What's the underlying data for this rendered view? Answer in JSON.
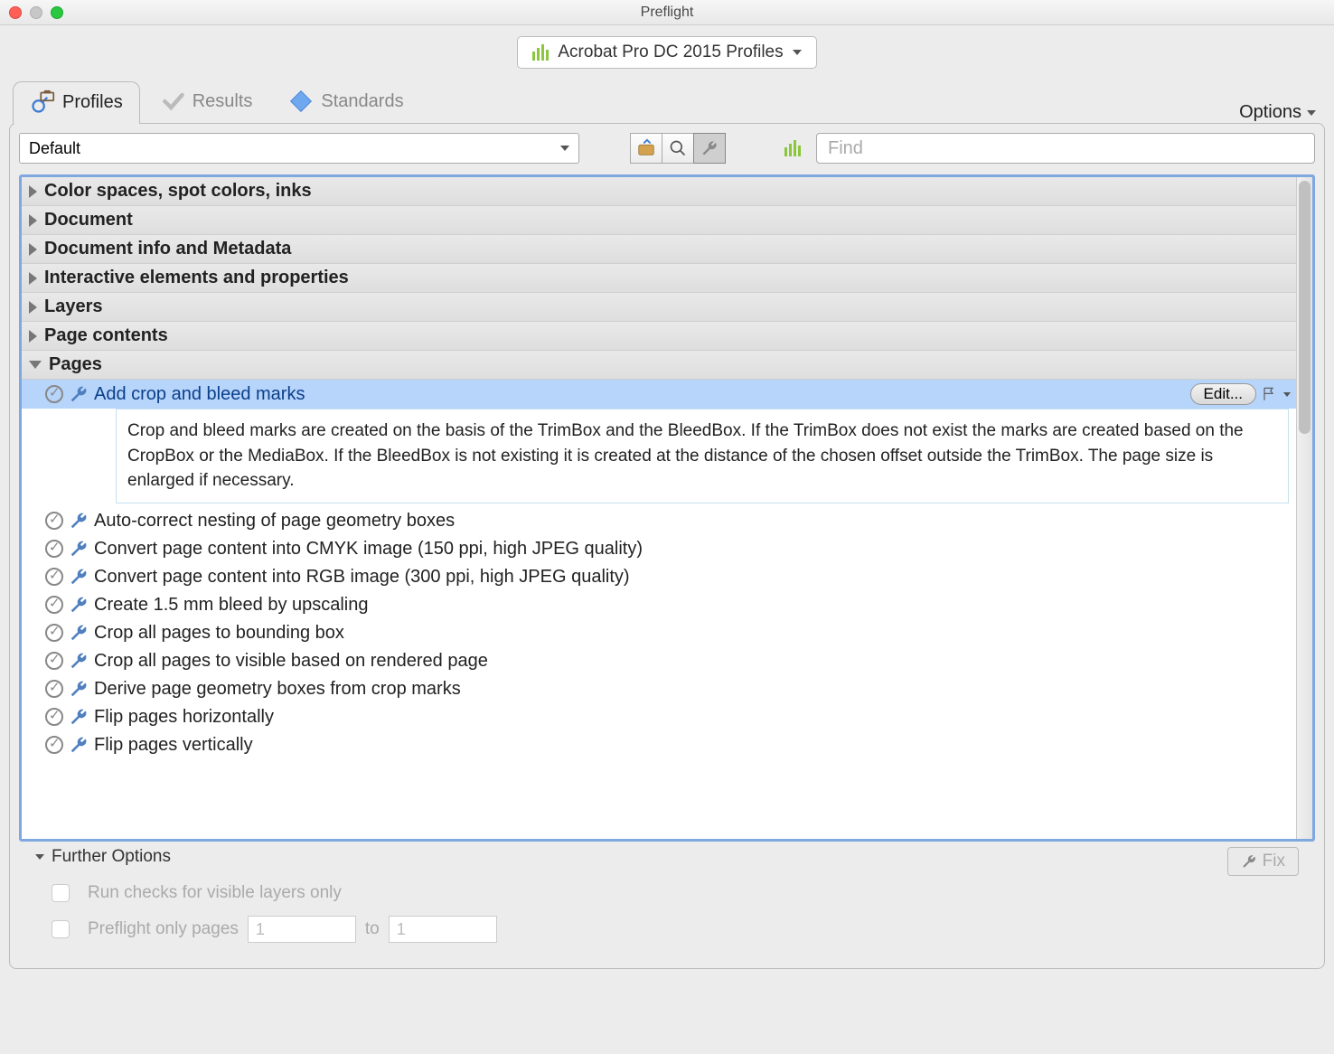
{
  "window": {
    "title": "Preflight"
  },
  "profile_selector": {
    "label": "Acrobat Pro DC 2015 Profiles"
  },
  "tabs": {
    "profiles": "Profiles",
    "results": "Results",
    "standards": "Standards"
  },
  "options_menu": "Options",
  "group_selector": "Default",
  "search": {
    "placeholder": "Find"
  },
  "categories": [
    {
      "label": "Color spaces, spot colors, inks",
      "expanded": false
    },
    {
      "label": "Document",
      "expanded": false
    },
    {
      "label": "Document info and Metadata",
      "expanded": false
    },
    {
      "label": "Interactive elements and properties",
      "expanded": false
    },
    {
      "label": "Layers",
      "expanded": false
    },
    {
      "label": "Page contents",
      "expanded": false
    },
    {
      "label": "Pages",
      "expanded": true
    }
  ],
  "selected_item": {
    "title": "Add crop and bleed marks",
    "edit_label": "Edit...",
    "description": "Crop and bleed marks are created on the basis of the TrimBox and the BleedBox. If the TrimBox does not exist the marks are created based on the CropBox or the MediaBox. If the BleedBox is not existing it is created at the distance of the chosen offset outside the TrimBox. The page size is enlarged if necessary."
  },
  "page_items": [
    "Auto-correct nesting of page geometry boxes",
    "Convert page content into CMYK image (150 ppi, high JPEG quality)",
    "Convert page content into RGB image (300 ppi, high JPEG quality)",
    "Create 1.5 mm bleed by upscaling",
    "Crop all pages to bounding box",
    "Crop all pages to visible based on rendered page",
    "Derive page geometry boxes from crop marks",
    "Flip pages horizontally",
    "Flip pages vertically"
  ],
  "footer": {
    "further_options": "Further Options",
    "fix": "Fix",
    "run_checks": "Run checks for visible layers only",
    "preflight_pages": "Preflight only pages",
    "to": "to",
    "page_from": "1",
    "page_to": "1"
  }
}
